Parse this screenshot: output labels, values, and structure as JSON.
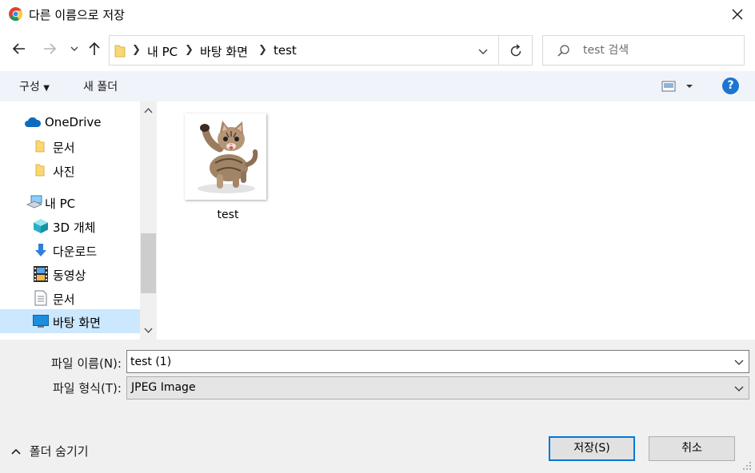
{
  "window": {
    "title": "다른 이름으로 저장",
    "icon": "chrome-icon"
  },
  "address": {
    "breadcrumb": [
      "내 PC",
      "바탕 화면",
      "test"
    ],
    "search_placeholder": "test 검색"
  },
  "toolbar": {
    "organize_label": "구성",
    "new_folder_label": "새 폴더",
    "help_label": "?"
  },
  "nav": {
    "items": [
      {
        "label": "OneDrive",
        "icon": "onedrive-cloud-icon"
      },
      {
        "label": "문서",
        "icon": "folder-icon"
      },
      {
        "label": "사진",
        "icon": "folder-icon"
      },
      {
        "label": "내 PC",
        "icon": "pc-icon"
      },
      {
        "label": "3D 개체",
        "icon": "3d-objects-icon"
      },
      {
        "label": "다운로드",
        "icon": "download-icon"
      },
      {
        "label": "동영상",
        "icon": "video-icon"
      },
      {
        "label": "문서",
        "icon": "document-icon"
      },
      {
        "label": "바탕 화면",
        "icon": "desktop-icon",
        "selected": true
      }
    ]
  },
  "files": [
    {
      "name": "test",
      "type": "image-thumbnail-kitten"
    }
  ],
  "form": {
    "filename_label": "파일 이름(N):",
    "filename_value": "test (1)",
    "filetype_label": "파일 형식(T):",
    "filetype_value": "JPEG Image"
  },
  "footer": {
    "hide_folders_label": "폴더 숨기기",
    "save_label": "저장(S)",
    "cancel_label": "취소"
  },
  "colors": {
    "accent": "#0078d7",
    "selection": "#cce8ff",
    "command_bar": "#f0f3f9",
    "help": "#1c75d0"
  }
}
